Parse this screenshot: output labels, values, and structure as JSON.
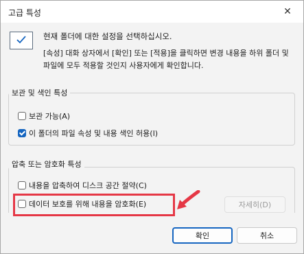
{
  "window": {
    "title": "고급 특성",
    "close_glyph": "✕"
  },
  "intro": {
    "line1": "현재 폴더에 대한 설정을 선택하십시오.",
    "line2": "[속성] 대화 상자에서 [확인] 또는 [적용]을 클릭하면 변경 내용을 하위 폴더 및 파일에 모두 적용할 것인지 사용자에게 확인합니다."
  },
  "archive_group": {
    "title": "보관 및 색인 특성",
    "items": [
      {
        "label": "보관 가능(A)",
        "checked": false
      },
      {
        "label": "이 폴더의 파일 속성 및 내용 색인 허용(I)",
        "checked": true
      }
    ]
  },
  "compress_group": {
    "title": "압축 또는 암호화 특성",
    "items": [
      {
        "label": "내용을 압축하여 디스크 공간 절약(C)",
        "checked": false
      },
      {
        "label": "데이터 보호를 위해 내용을 암호화(E)",
        "checked": false
      }
    ],
    "details_label": "자세히(D)"
  },
  "buttons": {
    "ok_label": "확인",
    "cancel_label": "취소"
  },
  "colors": {
    "accent": "#1565c0",
    "highlight": "#e53745"
  }
}
